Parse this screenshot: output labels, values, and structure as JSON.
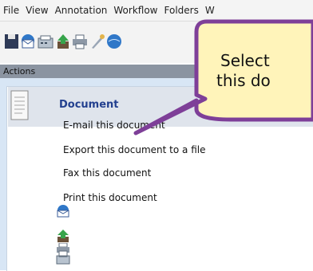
{
  "menu": [
    "File",
    "View",
    "Annotation",
    "Workflow",
    "Folders",
    "W"
  ],
  "toolbar": {
    "icons": [
      "save-icon",
      "email-icon",
      "fax-icon",
      "export-icon",
      "print-icon",
      "rocket-icon",
      "globe-icon"
    ]
  },
  "panel": {
    "header": "Actions",
    "section_title": "Document",
    "items": [
      {
        "label": "E-mail this document",
        "icon": "email-icon"
      },
      {
        "label": "Export this document to a file",
        "icon": "export-icon"
      },
      {
        "label": "Fax this document",
        "icon": "fax-icon"
      },
      {
        "label": "Print this document",
        "icon": "print-icon"
      }
    ]
  },
  "callout": {
    "line1": "Select",
    "line2": "this do"
  },
  "colors": {
    "accent": "#23408f",
    "callout_border": "#7e3f98",
    "callout_fill": "#fff4ba"
  }
}
